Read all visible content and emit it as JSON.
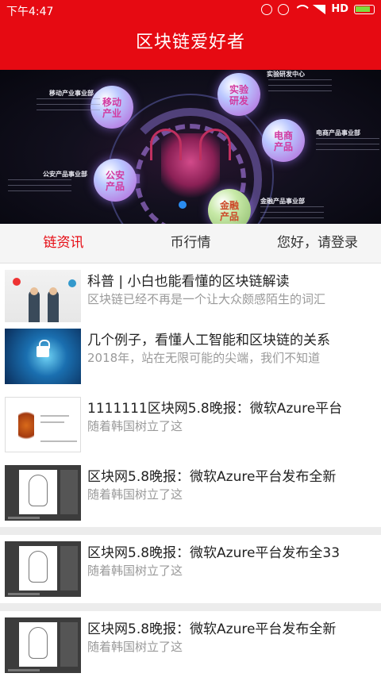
{
  "status_bar": {
    "time": "下午4:47",
    "network": "HD"
  },
  "app": {
    "title": "区块链爱好者"
  },
  "banner": {
    "bubbles": [
      {
        "label": "移动\n产业"
      },
      {
        "label": "实验\n研发"
      },
      {
        "label": "电商\n产品"
      },
      {
        "label": "公安\n产品"
      },
      {
        "label": "金融\n产品"
      }
    ],
    "departments": [
      {
        "name": "移动产业事业部"
      },
      {
        "name": "实验研发中心"
      },
      {
        "name": "电商产品事业部"
      },
      {
        "name": "公安产品事业部"
      },
      {
        "name": "金融产品事业部"
      }
    ]
  },
  "tabs": [
    {
      "label": "链资讯",
      "active": true
    },
    {
      "label": "币行情",
      "active": false
    },
    {
      "label": "您好，请登录",
      "active": false
    }
  ],
  "articles": [
    {
      "title": "科普 | 小白也能看懂的区块链解读",
      "summary": "区块链已经不再是一个让大众颇感陌生的词汇"
    },
    {
      "title": "几个例子，看懂人工智能和区块链的关系",
      "summary": "2018年，站在无限可能的尖端，我们不知道"
    },
    {
      "title": "1111111区块网5.8晚报：微软Azure平台",
      "summary": "随着韩国树立了这"
    },
    {
      "title": "区块网5.8晚报：微软Azure平台发布全新",
      "summary": "随着韩国树立了这"
    },
    {
      "title": "区块网5.8晚报：微软Azure平台发布全33",
      "summary": "随着韩国树立了这"
    },
    {
      "title": "区块网5.8晚报：微软Azure平台发布全新",
      "summary": "随着韩国树立了这"
    }
  ]
}
